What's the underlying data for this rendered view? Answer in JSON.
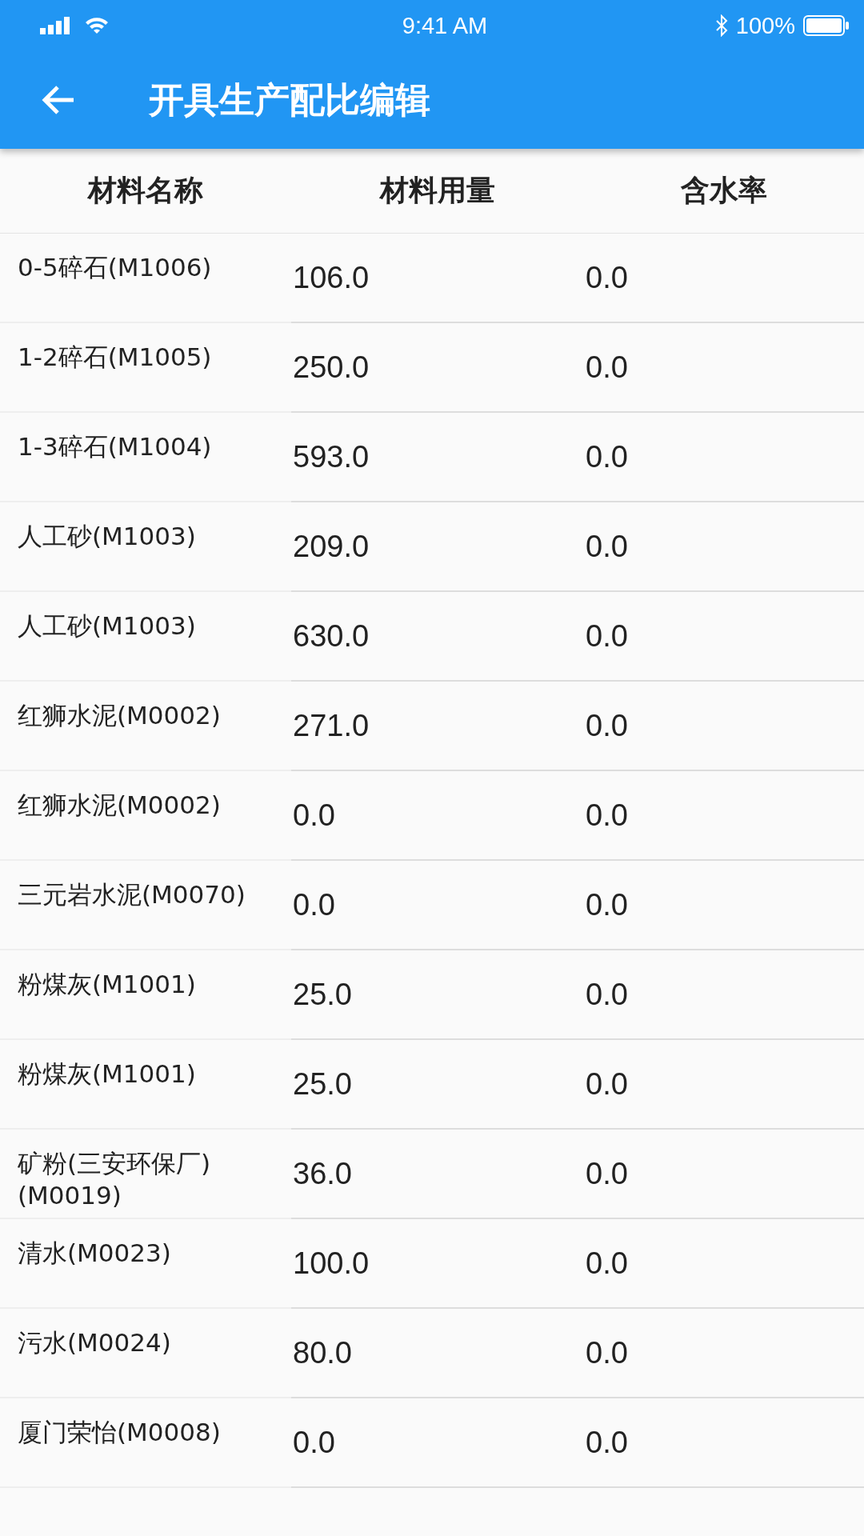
{
  "status_bar": {
    "time": "9:41 AM",
    "battery": "100%"
  },
  "app_bar": {
    "title": "开具生产配比编辑"
  },
  "table": {
    "columns": [
      "材料名称",
      "材料用量",
      "含水率"
    ],
    "rows": [
      {
        "name": "0-5碎石(M1006)",
        "amount": "106.0",
        "moisture": "0.0"
      },
      {
        "name": "1-2碎石(M1005)",
        "amount": "250.0",
        "moisture": "0.0"
      },
      {
        "name": "1-3碎石(M1004)",
        "amount": "593.0",
        "moisture": "0.0"
      },
      {
        "name": "人工砂(M1003)",
        "amount": "209.0",
        "moisture": "0.0"
      },
      {
        "name": "人工砂(M1003)",
        "amount": "630.0",
        "moisture": "0.0"
      },
      {
        "name": "红狮水泥(M0002)",
        "amount": "271.0",
        "moisture": "0.0"
      },
      {
        "name": "红狮水泥(M0002)",
        "amount": "0.0",
        "moisture": "0.0"
      },
      {
        "name": "三元岩水泥(M0070)",
        "amount": "0.0",
        "moisture": "0.0"
      },
      {
        "name": "粉煤灰(M1001)",
        "amount": "25.0",
        "moisture": "0.0"
      },
      {
        "name": "粉煤灰(M1001)",
        "amount": "25.0",
        "moisture": "0.0"
      },
      {
        "name": "矿粉(三安环保厂)(M0019)",
        "amount": "36.0",
        "moisture": "0.0"
      },
      {
        "name": "清水(M0023)",
        "amount": "100.0",
        "moisture": "0.0"
      },
      {
        "name": "污水(M0024)",
        "amount": "80.0",
        "moisture": "0.0"
      },
      {
        "name": "厦门荣怡(M0008)",
        "amount": "0.0",
        "moisture": "0.0"
      }
    ]
  }
}
